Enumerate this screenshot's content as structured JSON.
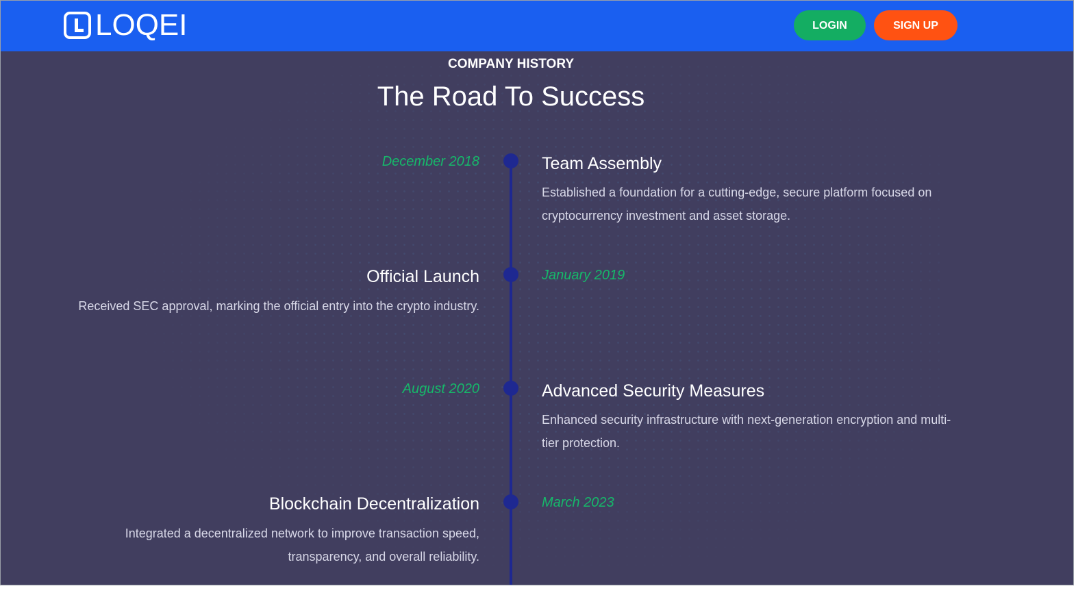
{
  "navbar": {
    "brand": "LOQEI",
    "login_label": "LOGIN",
    "signup_label": "SIGN UP",
    "colors": {
      "bar": "#1a5ff0",
      "login": "#14ad62",
      "signup": "#ff5212"
    }
  },
  "section": {
    "eyebrow": "COMPANY HISTORY",
    "title": "The Road To Success"
  },
  "timeline": {
    "items": [
      {
        "date": "December 2018",
        "title": "Team Assembly",
        "description": "Established a foundation for a cutting-edge, secure platform focused on cryptocurrency investment and asset storage."
      },
      {
        "date": "January 2019",
        "title": "Official Launch",
        "description": "Received SEC approval, marking the official entry into the crypto industry."
      },
      {
        "date": "August 2020",
        "title": "Advanced Security Measures",
        "description": "Enhanced security infrastructure with next-generation encryption and multi-tier protection."
      },
      {
        "date": "March 2023",
        "title": "Blockchain Decentralization",
        "description": "Integrated a decentralized network to improve transaction speed, transparency, and overall reliability."
      }
    ],
    "colors": {
      "date": "#16b86a",
      "line": "#1e2891",
      "background": "#413e5f"
    }
  }
}
